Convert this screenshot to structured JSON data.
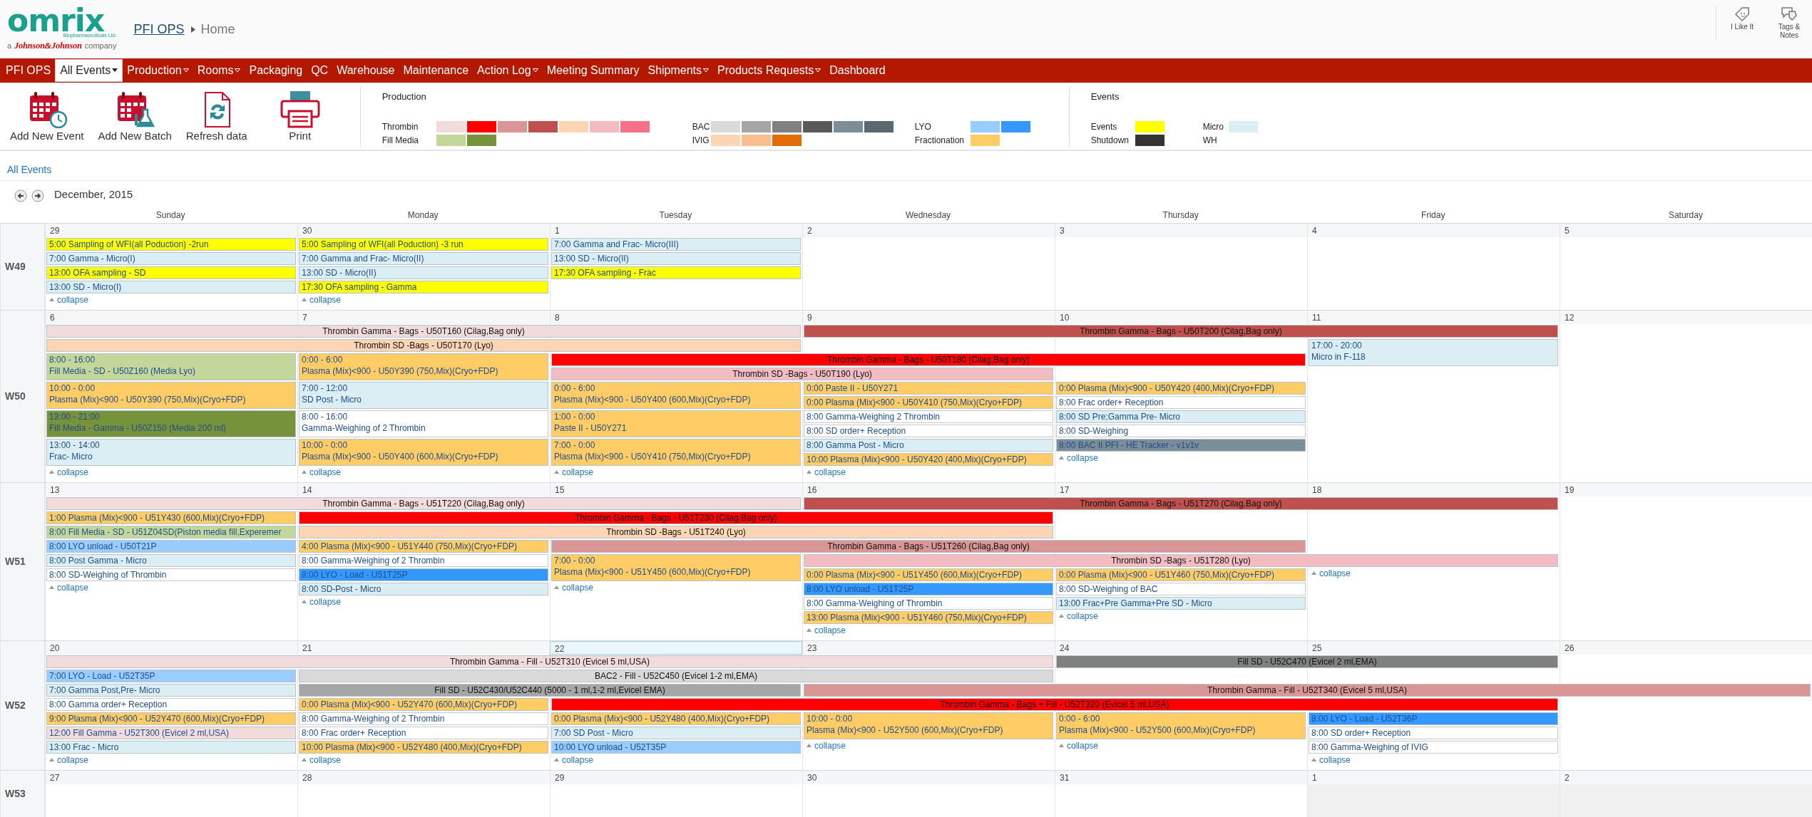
{
  "header": {
    "logo": {
      "name": "omrix",
      "subtitle": "Biopharmaceuticals Ltd.",
      "tagline": [
        "a",
        "Johnson&Johnson",
        "company"
      ]
    },
    "breadcrumb": [
      "PFI OPS",
      "Home"
    ],
    "actions": [
      {
        "label": "I Like It",
        "kind": "like"
      },
      {
        "label": "Tags & Notes",
        "kind": "tags"
      }
    ]
  },
  "nav": [
    {
      "label": "PFI OPS",
      "dropdown": false,
      "selected": false
    },
    {
      "label": "All Events",
      "dropdown": true,
      "selected": true
    },
    {
      "label": "Production",
      "dropdown": true,
      "selected": false
    },
    {
      "label": "Rooms",
      "dropdown": true,
      "selected": false
    },
    {
      "label": "Packaging",
      "dropdown": false,
      "selected": false
    },
    {
      "label": "QC",
      "dropdown": false,
      "selected": false
    },
    {
      "label": "Warehouse",
      "dropdown": false,
      "selected": false
    },
    {
      "label": "Maintenance",
      "dropdown": false,
      "selected": false
    },
    {
      "label": "Action Log",
      "dropdown": true,
      "selected": false
    },
    {
      "label": "Meeting Summary",
      "dropdown": false,
      "selected": false
    },
    {
      "label": "Shipments",
      "dropdown": true,
      "selected": false
    },
    {
      "label": "Products Requests",
      "dropdown": true,
      "selected": false
    },
    {
      "label": "Dashboard",
      "dropdown": false,
      "selected": false
    }
  ],
  "toolbar": [
    {
      "label": "Add New Event",
      "kind": "event"
    },
    {
      "label": "Add New Batch",
      "kind": "batch"
    },
    {
      "label": "Refresh data",
      "kind": "refresh"
    },
    {
      "label": "Print",
      "kind": "print"
    }
  ],
  "legend": [
    {
      "title": "Production",
      "columns": [
        [
          {
            "label": "Thrombin",
            "swatches": [
              {
                "color": "#f2dcdb"
              },
              {
                "color": "#ff0000"
              },
              {
                "color": "#da9694"
              },
              {
                "color": "#c0504d"
              },
              {
                "color": "#fcd5b4"
              },
              {
                "color": "#f2bcc2"
              },
              {
                "color": "#f67088"
              }
            ]
          },
          {
            "label": "Fill Media",
            "swatches": [
              {
                "color": "#c4d79b"
              },
              {
                "color": "#76933c"
              }
            ]
          }
        ],
        [
          {
            "label": "BAC",
            "swatches": [
              {
                "color": "#d9d9d9"
              },
              {
                "color": "#a6a6a6"
              },
              {
                "color": "#808080"
              },
              {
                "color": "#595959"
              },
              {
                "color": "#7b8d99"
              },
              {
                "color": "#5a6870"
              }
            ]
          },
          {
            "label": "IVIG",
            "swatches": [
              {
                "color": "#fcd5b4"
              },
              {
                "color": "#fabf8f"
              },
              {
                "color": "#e26b0a"
              }
            ]
          }
        ],
        [
          {
            "label": "LYO",
            "swatches": [
              {
                "color": "#99ccff"
              },
              {
                "color": "#3399ff"
              }
            ]
          },
          {
            "label": "Fractionation",
            "swatches": [
              {
                "color": "#ffcc66"
              }
            ]
          }
        ]
      ]
    },
    {
      "title": "Events",
      "columns": [
        [
          {
            "label": "Events",
            "swatches": [
              {
                "color": "#ffff00"
              }
            ]
          },
          {
            "label": "Shutdown",
            "swatches": [
              {
                "color": "#333333"
              }
            ]
          }
        ],
        [
          {
            "label": "Micro",
            "swatches": [
              {
                "color": "#daeef3"
              }
            ]
          },
          {
            "label": "WH"
          }
        ]
      ]
    }
  ],
  "view_link": "All Events",
  "month": "December, 2015",
  "weekdays": [
    "Sunday",
    "Monday",
    "Tuesday",
    "Wednesday",
    "Thursday",
    "Friday",
    "Saturday"
  ],
  "weeks": [
    {
      "label": "W49",
      "days": [
        {
          "number": "29",
          "today": false,
          "shaded": false
        },
        {
          "number": "30",
          "today": false,
          "shaded": false
        },
        {
          "number": "1",
          "today": false,
          "shaded": false
        },
        {
          "number": "2",
          "today": false,
          "shaded": false
        },
        {
          "number": "3",
          "today": false,
          "shaded": false
        },
        {
          "number": "4",
          "today": false,
          "shaded": false
        },
        {
          "number": "5",
          "today": false,
          "shaded": false
        }
      ],
      "lanes": [
        [
          {
            "kind": "item",
            "text": "5:00 Sampling of WFI(all Poduction) -2run",
            "color": "#ffff00"
          },
          {
            "kind": "item",
            "text": "5:00 Sampling of WFI(all Poduction) -3 run",
            "color": "#ffff00"
          },
          {
            "kind": "item",
            "text": "7:00 Gamma and Frac- Micro(III)",
            "color": "#daeef3"
          }
        ],
        [
          {
            "kind": "item",
            "text": "7:00 Gamma - Micro(I)",
            "color": "#daeef3"
          },
          {
            "kind": "item",
            "text": "7:00 Gamma and Frac- Micro(II)",
            "color": "#daeef3"
          },
          {
            "kind": "item",
            "text": "13:00 SD - Micro(II)",
            "color": "#daeef3"
          }
        ],
        [
          {
            "kind": "item",
            "text": "13:00 OFA sampling - SD",
            "color": "#ffff00"
          },
          {
            "kind": "item",
            "text": "13:00 SD - Micro(II)",
            "color": "#daeef3"
          },
          {
            "kind": "item",
            "text": "17:30 OFA sampling - Frac",
            "color": "#ffff00"
          }
        ],
        [
          {
            "kind": "item",
            "text": "13:00 SD - Micro(I)",
            "color": "#daeef3"
          },
          {
            "kind": "item",
            "text": "17:30 OFA sampling - Gamma",
            "color": "#ffff00"
          }
        ],
        [
          {
            "kind": "link",
            "text": "collapse"
          },
          {
            "kind": "link",
            "text": "collapse"
          }
        ]
      ]
    },
    {
      "label": "W50",
      "days": [
        {
          "number": "6",
          "today": false,
          "shaded": false
        },
        {
          "number": "7",
          "today": false,
          "shaded": false
        },
        {
          "number": "8",
          "today": false,
          "shaded": false
        },
        {
          "number": "9",
          "today": false,
          "shaded": false
        },
        {
          "number": "10",
          "today": false,
          "shaded": false
        },
        {
          "number": "11",
          "today": false,
          "shaded": false
        },
        {
          "number": "12",
          "today": false,
          "shaded": false
        }
      ],
      "lanes": [
        [
          {
            "kind": "bar",
            "text": "Thrombin Gamma - Bags - U50T160 (Cilag,Bag only)",
            "color": "#f2dcdb"
          },
          {
            "continues": true
          },
          {
            "continues": true
          },
          {
            "kind": "bar",
            "text": "Thrombin Gamma - Bags - U50T200 (Cilag,Bag only)",
            "color": "#c0504d"
          },
          {
            "continues": true
          },
          {
            "continues": true
          }
        ],
        [
          {
            "kind": "bar",
            "text": "Thrombin SD -Bags - U50T170 (Lyo)",
            "color": "#fcd5b4"
          },
          {
            "continues": true
          },
          {
            "continues": true
          },
          {
            "kind": "blank"
          },
          {
            "kind": "blank"
          },
          {
            "kind": "timed",
            "time": "17:00 - 20:00",
            "text": "Micro in F-118",
            "color": "#daeef3"
          }
        ],
        [
          {
            "kind": "timed",
            "time": "8:00 - 16:00",
            "text": "Fill Media - SD - U50Z160 (Media Lyo)",
            "color": "#c4d79b"
          },
          {
            "kind": "timed",
            "time": "0:00 - 6:00",
            "text": "Plasma (Mix)<900 - U50Y390 (750,Mix)(Cryo+FDP)",
            "color": "#ffcc66"
          },
          {
            "kind": "bar",
            "text": "Thrombin Gamma - Bags - U50T180 (Cilag,Bag only)",
            "color": "#ff0000"
          },
          {
            "continues": true
          },
          {
            "continues": true
          },
          {
            "extends": true
          }
        ],
        [
          {
            "extends": true
          },
          {
            "extends": true
          },
          {
            "kind": "bar",
            "text": "Thrombin SD -Bags - U50T190 (Lyo)",
            "color": "#f2bcc2"
          },
          {
            "continues": true
          }
        ],
        [
          {
            "kind": "timed",
            "time": "10:00 - 0:00",
            "text": "Plasma (Mix)<900 - U50Y390 (750,Mix)(Cryo+FDP)",
            "color": "#ffcc66"
          },
          {
            "kind": "timed",
            "time": "7:00 - 12:00",
            "text": "SD Post - Micro",
            "color": "#daeef3"
          },
          {
            "kind": "timed",
            "time": "0:00 - 6:00",
            "text": "Plasma (Mix)<900 - U50Y400 (600,Mix)(Cryo+FDP)",
            "color": "#ffcc66"
          },
          {
            "kind": "item",
            "text": "0:00 Paste II - U50Y271",
            "color": "#ffcc66"
          },
          {
            "kind": "item",
            "text": "0:00 Plasma (Mix)<900 - U50Y420 (400,Mix)(Cryo+FDP)",
            "color": "#ffcc66"
          }
        ],
        [
          {
            "extends": true
          },
          {
            "extends": true
          },
          {
            "extends": true
          },
          {
            "kind": "item",
            "text": "0:00 Plasma (Mix)<900 - U50Y410 (750,Mix)(Cryo+FDP)",
            "color": "#ffcc66"
          },
          {
            "kind": "item",
            "text": "8:00 Frac order+ Reception",
            "color": "#ffffff"
          }
        ],
        [
          {
            "kind": "timed",
            "time": "13:00 - 21:00",
            "text": "Fill Media - Gamma - U50Z150 (Media 200 ml)",
            "color": "#76933c"
          },
          {
            "kind": "timed",
            "time": "8:00 - 16:00",
            "text": "Gamma-Weighing of 2 Thrombin",
            "color": "#ffffff"
          },
          {
            "kind": "timed",
            "time": "1:00 - 0:00",
            "text": "Paste II - U50Y271",
            "color": "#ffcc66"
          },
          {
            "kind": "item",
            "text": "8:00 Gamma-Weighing 2 Thrombin",
            "color": "#ffffff"
          },
          {
            "kind": "item",
            "text": "8:00 SD Pre;Gamma Pre- Micro",
            "color": "#daeef3"
          }
        ],
        [
          {
            "extends": true
          },
          {
            "extends": true
          },
          {
            "extends": true
          },
          {
            "kind": "item",
            "text": "8:00 SD order+ Reception",
            "color": "#ffffff"
          },
          {
            "kind": "item",
            "text": "8:00 SD-Weighing",
            "color": "#ffffff"
          }
        ],
        [
          {
            "kind": "timed",
            "time": "13:00 - 14:00",
            "text": "Frac- Micro",
            "color": "#daeef3"
          },
          {
            "kind": "timed",
            "time": "10:00 - 0:00",
            "text": "Plasma (Mix)<900 - U50Y400 (600,Mix)(Cryo+FDP)",
            "color": "#ffcc66"
          },
          {
            "kind": "timed",
            "time": "7:00 - 0:00",
            "text": "Plasma (Mix)<900 - U50Y410 (750,Mix)(Cryo+FDP)",
            "color": "#ffcc66"
          },
          {
            "kind": "item",
            "text": "8:00 Gamma Post - Micro",
            "color": "#daeef3"
          },
          {
            "kind": "item",
            "text": "8:00 BAC II PFI - HE Tracker - v1v1v",
            "color": "#7b8d99"
          }
        ],
        [
          {
            "extends": true
          },
          {
            "extends": true
          },
          {
            "extends": true
          },
          {
            "kind": "item",
            "text": "10:00 Plasma (Mix)<900 - U50Y420 (400,Mix)(Cryo+FDP)",
            "color": "#ffcc66"
          },
          {
            "kind": "link",
            "text": "collapse"
          }
        ],
        [
          {
            "kind": "link",
            "text": "collapse"
          },
          {
            "kind": "link",
            "text": "collapse"
          },
          {
            "kind": "link",
            "text": "collapse"
          },
          {
            "kind": "link",
            "text": "collapse"
          }
        ]
      ]
    },
    {
      "label": "W51",
      "days": [
        {
          "number": "13",
          "today": false,
          "shaded": false
        },
        {
          "number": "14",
          "today": false,
          "shaded": false
        },
        {
          "number": "15",
          "today": false,
          "shaded": false
        },
        {
          "number": "16",
          "today": false,
          "shaded": false
        },
        {
          "number": "17",
          "today": false,
          "shaded": false
        },
        {
          "number": "18",
          "today": false,
          "shaded": false
        },
        {
          "number": "19",
          "today": false,
          "shaded": false
        }
      ],
      "lanes": [
        [
          {
            "kind": "bar",
            "text": "Thrombin Gamma - Bags - U51T220 (Cilag,Bag only)",
            "color": "#f2dcdb"
          },
          {
            "continues": true
          },
          {
            "continues": true
          },
          {
            "kind": "bar",
            "text": "Thrombin Gamma - Bags - U51T270 (Cilag,Bag only)",
            "color": "#c0504d"
          },
          {
            "continues": true
          },
          {
            "continues": true
          }
        ],
        [
          {
            "kind": "item",
            "text": "1:00 Plasma (Mix)<900 - U51Y430 (600,Mix)(Cryo+FDP)",
            "color": "#ffcc66"
          },
          {
            "kind": "bar",
            "text": "Thrombin Gamma - Bags - U51T230 (Cilag,Bag only)",
            "color": "#ff0000"
          },
          {
            "continues": true
          },
          {
            "continues": true
          }
        ],
        [
          {
            "kind": "item",
            "text": "8:00 Fill Media - SD - U51Z04SD(Piston media fill,Experemer",
            "color": "#c4d79b"
          },
          {
            "kind": "bar",
            "text": "Thrombin SD -Bags - U51T240 (Lyo)",
            "color": "#fcd5b4"
          },
          {
            "continues": true
          },
          {
            "continues": true
          }
        ],
        [
          {
            "kind": "item",
            "text": "8:00 LYO unload - U50T21P",
            "color": "#99ccff"
          },
          {
            "kind": "item",
            "text": "4:00 Plasma (Mix)<900 - U51Y440 (750,Mix)(Cryo+FDP)",
            "color": "#ffcc66"
          },
          {
            "kind": "bar",
            "text": "Thrombin Gamma - Bags - U51T260 (Cilag,Bag only)",
            "color": "#da9694"
          },
          {
            "continues": true
          },
          {
            "continues": true
          }
        ],
        [
          {
            "kind": "item",
            "text": "8:00 Post Gamma - Micro",
            "color": "#daeef3"
          },
          {
            "kind": "item",
            "text": "8:00 Gamma-Weighing of 2 Thrombin",
            "color": "#ffffff"
          },
          {
            "kind": "timed",
            "time": "7:00 - 0:00",
            "text": "Plasma (Mix)<900 - U51Y450 (600,Mix)(Cryo+FDP)",
            "color": "#ffcc66"
          },
          {
            "kind": "bar",
            "text": "Thrombin SD -Bags - U51T280 (Lyo)",
            "color": "#f2bcc2"
          },
          {
            "continues": true
          },
          {
            "continues": true
          }
        ],
        [
          {
            "kind": "item",
            "text": "8:00 SD-Weighing of Thrombin",
            "color": "#ffffff"
          },
          {
            "kind": "item",
            "text": "8:00 LYO - Load - U51T25P",
            "color": "#3399ff"
          },
          {
            "extends": true
          },
          {
            "kind": "item",
            "text": "0:00 Plasma (Mix)<900 - U51Y450 (600,Mix)(Cryo+FDP)",
            "color": "#ffcc66"
          },
          {
            "kind": "item",
            "text": "0:00 Plasma (Mix)<900 - U51Y460 (750,Mix)(Cryo+FDP)",
            "color": "#ffcc66"
          },
          {
            "kind": "link",
            "text": "collapse"
          }
        ],
        [
          {
            "kind": "link",
            "text": "collapse"
          },
          {
            "kind": "item",
            "text": "8:00 SD-Post - Micro",
            "color": "#daeef3"
          },
          {
            "kind": "link",
            "text": "collapse"
          },
          {
            "kind": "item",
            "text": "8:00 LYO unload - U51T25P",
            "color": "#3399ff"
          },
          {
            "kind": "item",
            "text": "8:00 SD-Weighing of BAC",
            "color": "#ffffff"
          }
        ],
        [
          {
            "kind": "blank"
          },
          {
            "kind": "link",
            "text": "collapse"
          },
          {
            "kind": "blank"
          },
          {
            "kind": "item",
            "text": "8:00 Gamma-Weighing of Thrombin",
            "color": "#ffffff"
          },
          {
            "kind": "item",
            "text": "13:00 Frac+Pre Gamma+Pre SD - Micro",
            "color": "#daeef3"
          }
        ],
        [
          {
            "kind": "blank"
          },
          {
            "kind": "blank"
          },
          {
            "kind": "blank"
          },
          {
            "kind": "item",
            "text": "13:00 Plasma (Mix)<900 - U51Y460 (750,Mix)(Cryo+FDP)",
            "color": "#ffcc66"
          },
          {
            "kind": "link",
            "text": "collapse"
          }
        ],
        [
          {
            "kind": "blank"
          },
          {
            "kind": "blank"
          },
          {
            "kind": "blank"
          },
          {
            "kind": "link",
            "text": "collapse"
          }
        ]
      ]
    },
    {
      "label": "W52",
      "days": [
        {
          "number": "20",
          "today": false,
          "shaded": false
        },
        {
          "number": "21",
          "today": false,
          "shaded": false
        },
        {
          "number": "22",
          "today": true,
          "shaded": false
        },
        {
          "number": "23",
          "today": false,
          "shaded": false
        },
        {
          "number": "24",
          "today": false,
          "shaded": false
        },
        {
          "number": "25",
          "today": false,
          "shaded": false
        },
        {
          "number": "26",
          "today": false,
          "shaded": false
        }
      ],
      "lanes": [
        [
          {
            "kind": "bar",
            "text": "Thrombin Gamma - Fill - U52T310 (Evicel 5 ml,USA)",
            "color": "#f2dcdb"
          },
          {
            "continues": true
          },
          {
            "continues": true
          },
          {
            "continues": true
          },
          {
            "kind": "bar",
            "text": "Fill SD - U52C470 (Evicel 2 ml,EMA)",
            "color": "#808080"
          },
          {
            "continues": true
          }
        ],
        [
          {
            "kind": "item",
            "text": "7:00 LYO - Load - U52T35P",
            "color": "#99ccff"
          },
          {
            "kind": "bar",
            "text": "BAC2 - Fill - U52C450 (Evicel 1-2 ml,EMA)",
            "color": "#d9d9d9"
          },
          {
            "continues": true
          },
          {
            "continues": true
          }
        ],
        [
          {
            "kind": "item",
            "text": "7:00 Gamma Post,Pre- Micro",
            "color": "#daeef3"
          },
          {
            "kind": "bar",
            "text": "Fill SD - U52C430/U52C440 (5000 - 1 ml,1-2 ml,Evicel EMA)",
            "color": "#a6a6a6"
          },
          {
            "continues": true
          },
          {
            "kind": "bar",
            "text": "Thrombin Gamma - Fill - U52T340 (Evicel 5 ml,USA)",
            "color": "#da9694"
          },
          {
            "continues": true
          },
          {
            "continues": true
          },
          {
            "continues": true
          }
        ],
        [
          {
            "kind": "item",
            "text": "8:00 Gamma order+ Reception",
            "color": "#ffffff"
          },
          {
            "kind": "item",
            "text": "0:00 Plasma (Mix)<900 - U52Y470 (600,Mix)(Cryo+FDP)",
            "color": "#ffcc66"
          },
          {
            "kind": "bar",
            "text": "Thrombin Gamma - Bags + Fill - U52T320 (Evicel 5 ml,USA)",
            "color": "#ff0000"
          },
          {
            "continues": true
          },
          {
            "continues": true
          },
          {
            "continues": true
          }
        ],
        [
          {
            "kind": "item",
            "text": "9:00 Plasma (Mix)<900 - U52Y470 (600,Mix)(Cryo+FDP)",
            "color": "#ffcc66"
          },
          {
            "kind": "item",
            "text": "8:00 Gamma-Weighing of 2 Thrombin",
            "color": "#ffffff"
          },
          {
            "kind": "item",
            "text": "0:00 Plasma (Mix)<900 - U52Y480 (400,Mix)(Cryo+FDP)",
            "color": "#ffcc66"
          },
          {
            "kind": "timed",
            "time": "10:00 - 0:00",
            "text": "Plasma (Mix)<900 - U52Y500 (600,Mix)(Cryo+FDP)",
            "color": "#ffcc66"
          },
          {
            "kind": "timed",
            "time": "0:00 - 6:00",
            "text": "Plasma (Mix)<900 - U52Y500 (600,Mix)(Cryo+FDP)",
            "color": "#ffcc66"
          },
          {
            "kind": "item",
            "text": "8:00 LYO - Load - U52T36P",
            "color": "#3399ff"
          }
        ],
        [
          {
            "kind": "item",
            "text": "12:00 Fill Gamma - U52T300 (Evicel 2 ml,USA)",
            "color": "#f2dcdb"
          },
          {
            "kind": "item",
            "text": "8:00 Frac order+ Reception",
            "color": "#ffffff"
          },
          {
            "kind": "item",
            "text": "7:00 SD Post - Micro",
            "color": "#daeef3"
          },
          {
            "extends": true
          },
          {
            "extends": true
          },
          {
            "kind": "item",
            "text": "8:00 SD order+ Reception",
            "color": "#ffffff"
          }
        ],
        [
          {
            "kind": "item",
            "text": "13:00 Frac - Micro",
            "color": "#daeef3"
          },
          {
            "kind": "item",
            "text": "10:00 Plasma (Mix)<900 - U52Y480 (400,Mix)(Cryo+FDP)",
            "color": "#ffcc66"
          },
          {
            "kind": "item",
            "text": "10:00 LYO unload - U52T35P",
            "color": "#99ccff"
          },
          {
            "kind": "link",
            "text": "collapse"
          },
          {
            "kind": "link",
            "text": "collapse"
          },
          {
            "kind": "item",
            "text": "8:00 Gamma-Weighing of IVIG",
            "color": "#ffffff"
          }
        ],
        [
          {
            "kind": "link",
            "text": "collapse"
          },
          {
            "kind": "link",
            "text": "collapse"
          },
          {
            "kind": "link",
            "text": "collapse"
          },
          {
            "kind": "blank"
          },
          {
            "kind": "blank"
          },
          {
            "kind": "link",
            "text": "collapse"
          }
        ]
      ]
    },
    {
      "label": "W53",
      "days": [
        {
          "number": "27",
          "today": false,
          "shaded": false
        },
        {
          "number": "28",
          "today": false,
          "shaded": false
        },
        {
          "number": "29",
          "today": false,
          "shaded": false
        },
        {
          "number": "30",
          "today": false,
          "shaded": false
        },
        {
          "number": "31",
          "today": false,
          "shaded": false
        },
        {
          "number": "1",
          "today": false,
          "shaded": true
        },
        {
          "number": "2",
          "today": false,
          "shaded": true
        }
      ]
    }
  ]
}
